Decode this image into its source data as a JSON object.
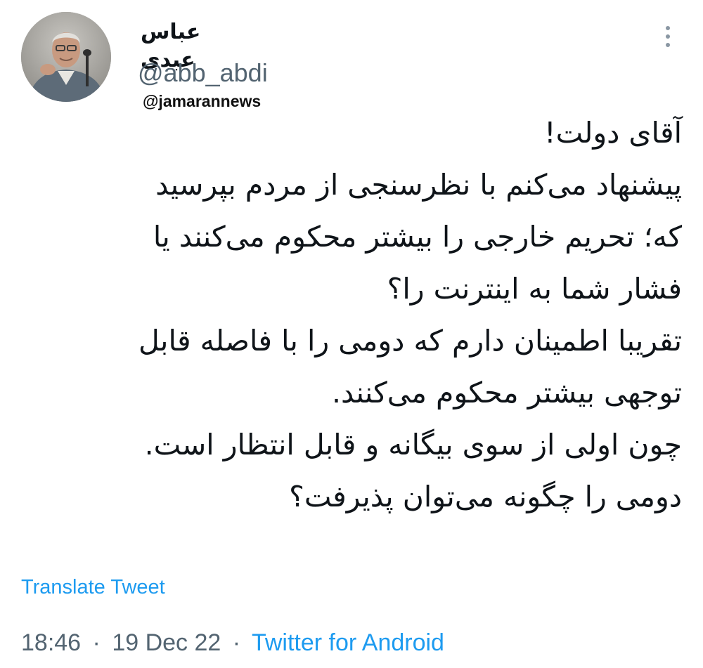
{
  "author": {
    "display_name": "عباس عبدی",
    "handle": "@abb_abdi",
    "avatar_icon": "person-photo-avatar"
  },
  "watermark": "@jamarannews",
  "menu": {
    "icon": "more-vertical-icon"
  },
  "tweet": {
    "lines": [
      "آقای دولت!",
      "پیشنهاد می‌کنم با نظرسنجی از مردم بپرسید",
      "که؛ تحریم خارجی را بیشتر محکوم می‌کنند یا",
      "فشار شما به اینترنت را؟",
      "تقریبا اطمینان دارم که دومی را با فاصله قابل",
      "توجهی بیشتر محکوم می‌کنند.",
      "چون اولی از سوی بیگانه و قابل انتظار است.",
      "دومی را چگونه می‌توان پذیرفت؟"
    ]
  },
  "translate_label": "Translate Tweet",
  "meta": {
    "time": "18:46",
    "separator": "·",
    "date": "19 Dec 22",
    "source": "Twitter for Android"
  },
  "colors": {
    "text": "#0f1419",
    "secondary": "#536471",
    "link": "#1d9bf0"
  }
}
